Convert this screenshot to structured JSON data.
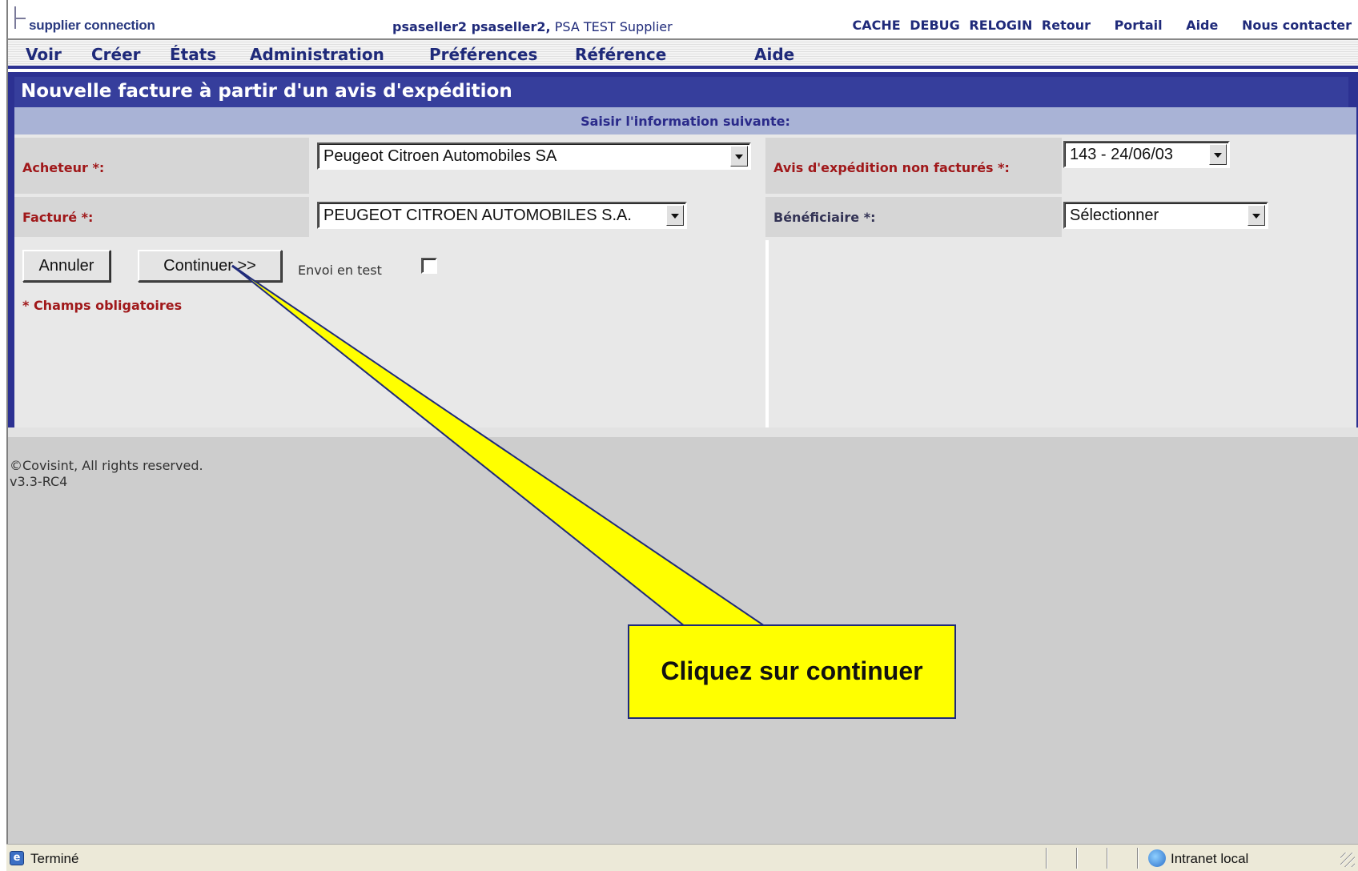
{
  "header": {
    "logo_text": "supplier connection",
    "user_name": "psaseller2 psaseller2,",
    "company": " PSA TEST Supplier",
    "links": [
      "CACHE",
      "DEBUG",
      "RELOGIN",
      "Retour",
      "Portail",
      "Aide",
      "Nous contacter"
    ]
  },
  "menu": {
    "items": [
      "Voir",
      "Créer",
      "États",
      "Administration",
      "Préférences",
      "Référence",
      "Aide"
    ]
  },
  "page": {
    "title": "Nouvelle facture à partir d'un avis d'expédition",
    "subtitle": "Saisir l'information suivante:"
  },
  "form": {
    "acheteur_label": "Acheteur *:",
    "acheteur_value": "Peugeot Citroen Automobiles SA",
    "avis_label": "Avis d'expédition non facturés *:",
    "avis_value": "143 - 24/06/03",
    "facture_label": "Facturé *:",
    "facture_value": "PEUGEOT CITROEN AUTOMOBILES S.A.",
    "beneficiaire_label": "Bénéficiaire *:",
    "beneficiaire_value": "Sélectionner",
    "cancel_label": "Annuler",
    "continue_label": "Continuer >>",
    "envoi_label": "Envoi en test",
    "envoi_checked": false,
    "required_note": "* Champs obligatoires"
  },
  "footer": {
    "copyright": "©Covisint, All rights reserved.",
    "version": "v3.3-RC4"
  },
  "callout": {
    "text": "Cliquez sur continuer"
  },
  "statusbar": {
    "status": "Terminé",
    "zone": "Intranet local"
  },
  "colors": {
    "brand_blue": "#2c3192",
    "subhead": "#a9b3d6",
    "required_red": "#a0181a",
    "callout_yellow": "#ffff00"
  }
}
